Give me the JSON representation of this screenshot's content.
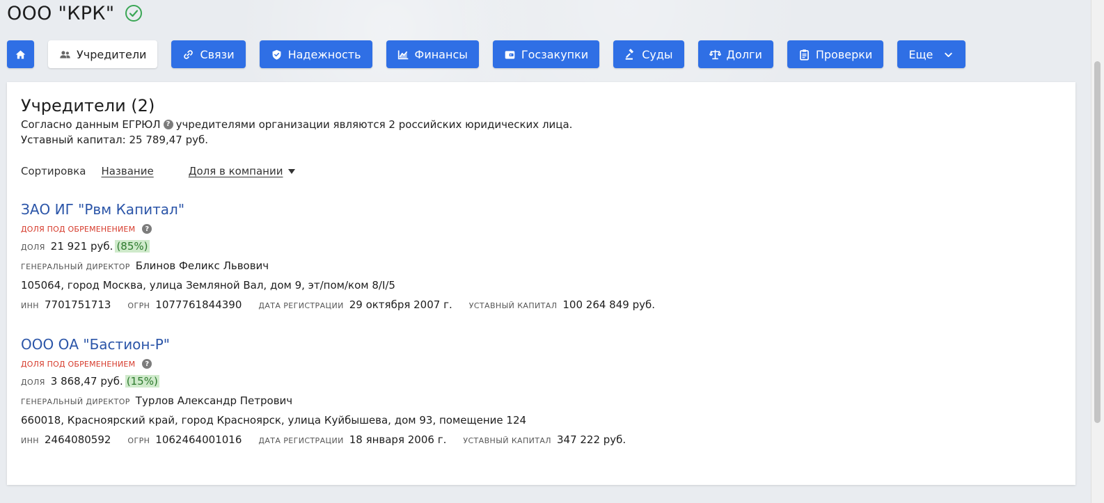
{
  "company": {
    "title": "ООО \"КРК\""
  },
  "nav": {
    "items": [
      {
        "label": "",
        "icon": "home-icon"
      },
      {
        "label": "Учредители",
        "icon": "people-icon",
        "active": true
      },
      {
        "label": "Связи",
        "icon": "link-icon"
      },
      {
        "label": "Надежность",
        "icon": "shield-icon"
      },
      {
        "label": "Финансы",
        "icon": "chart-icon"
      },
      {
        "label": "Госзакупки",
        "icon": "wallet-icon"
      },
      {
        "label": "Суды",
        "icon": "gavel-icon"
      },
      {
        "label": "Долги",
        "icon": "scales-icon"
      },
      {
        "label": "Проверки",
        "icon": "clipboard-icon"
      },
      {
        "label": "Еще",
        "icon": "chevron-down-icon"
      }
    ]
  },
  "founders_section": {
    "title": "Учредители (2)",
    "desc_before": "Согласно данным ЕГРЮЛ",
    "desc_after": "учредителями организации являются 2 российских юридических лица.",
    "capital": "Уставный капитал: 25 789,47 руб.",
    "sort_label": "Сортировка",
    "sort_by_name": "Название",
    "sort_by_share": "Доля в компании"
  },
  "founders": [
    {
      "name": "ЗАО ИГ \"Рвм Капитал\"",
      "encumbrance": "ДОЛЯ ПОД ОБРЕМЕНЕНИЕМ",
      "share_label": "ДОЛЯ",
      "share_value": "21 921 руб.",
      "share_pct": "(85%)",
      "director_label": "ГЕНЕРАЛЬНЫЙ ДИРЕКТОР",
      "director": "Блинов Феликс Львович",
      "address": "105064, город Москва, улица Земляной Вал, дом 9, эт/пом/ком 8/I/5",
      "inn_label": "ИНН",
      "inn": "7701751713",
      "ogrn_label": "ОГРН",
      "ogrn": "1077761844390",
      "reg_label": "ДАТА РЕГИСТРАЦИИ",
      "reg": "29 октября 2007 г.",
      "cap_label": "УСТАВНЫЙ КАПИТАЛ",
      "cap": "100 264 849 руб."
    },
    {
      "name": "ООО ОА \"Бастион-Р\"",
      "encumbrance": "ДОЛЯ ПОД ОБРЕМЕНЕНИЕМ",
      "share_label": "ДОЛЯ",
      "share_value": "3 868,47 руб.",
      "share_pct": "(15%)",
      "director_label": "ГЕНЕРАЛЬНЫЙ ДИРЕКТОР",
      "director": "Турлов Александр Петрович",
      "address": "660018, Красноярский край, город Красноярск, улица Куйбышева, дом 93, помещение 124",
      "inn_label": "ИНН",
      "inn": "2464080592",
      "ogrn_label": "ОГРН",
      "ogrn": "1062464001016",
      "reg_label": "ДАТА РЕГИСТРАЦИИ",
      "reg": "18 января 2006 г.",
      "cap_label": "УСТАВНЫЙ КАПИТАЛ",
      "cap": "347 222 руб."
    }
  ],
  "colors": {
    "accent": "#2f6fe5",
    "link": "#2b55a8",
    "danger": "#d63a2b",
    "pct_bg": "#cfeacb",
    "pct_text": "#2d7a2d",
    "verified": "#3aa655"
  }
}
